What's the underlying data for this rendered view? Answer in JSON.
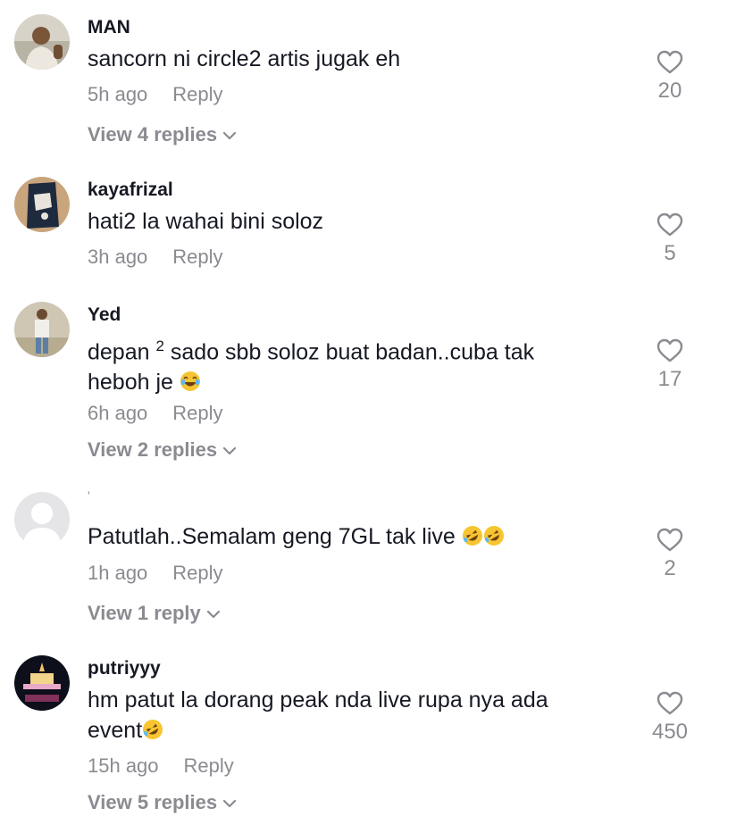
{
  "comments": [
    {
      "username": "MAN",
      "text": "sancorn ni circle2 artis jugak eh",
      "time": "5h ago",
      "reply": "Reply",
      "likes": "20",
      "view_replies": "View 4 replies"
    },
    {
      "username": "kayafrizal",
      "text": "hati2 la wahai bini soloz",
      "time": "3h ago",
      "reply": "Reply",
      "likes": "5"
    },
    {
      "username": "Yed",
      "text_before": "depan ",
      "text_sup": "2",
      "text_after": " sado sbb soloz buat badan..cuba tak heboh je",
      "emoji": "face-with-tears-of-joy",
      "time": "6h ago",
      "reply": "Reply",
      "likes": "17",
      "view_replies": "View 2 replies"
    },
    {
      "username": "'",
      "text": "Patutlah..Semalam geng 7GL tak live",
      "emoji": "rolling-on-floor-laughing",
      "time": "1h ago",
      "reply": "Reply",
      "likes": "2",
      "view_replies": "View 1 reply"
    },
    {
      "username": "putriyyy",
      "text": "hm patut la dorang peak nda live rupa nya ada event",
      "emoji": "rolling-on-floor-laughing",
      "time": "15h ago",
      "reply": "Reply",
      "likes": "450",
      "view_replies": "View 5 replies"
    }
  ],
  "colors": {
    "text": "#161823",
    "muted": "#8a8b91"
  }
}
